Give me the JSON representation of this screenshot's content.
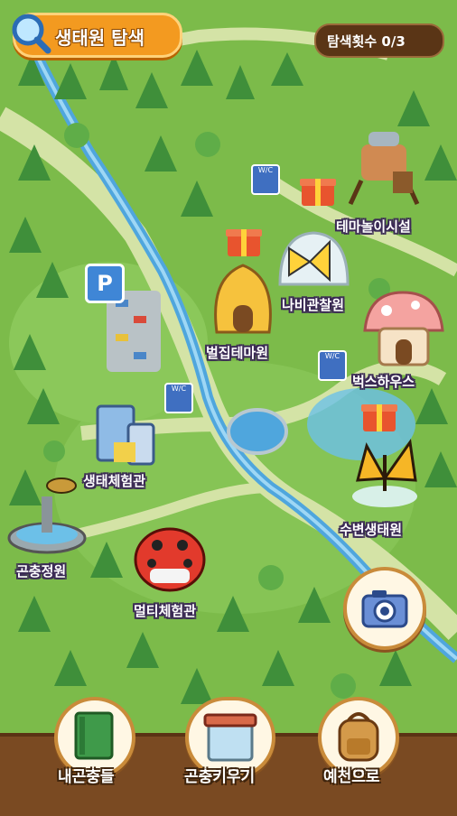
{
  "header": {
    "title": "생태원 탐색",
    "search_count": "탐색횟수 0/3"
  },
  "map": {
    "locations": [
      {
        "label": "테마놀이시설"
      },
      {
        "label": "나비관찰원"
      },
      {
        "label": "벌집테마원"
      },
      {
        "label": "벅스하우스"
      },
      {
        "label": "생태체험관"
      },
      {
        "label": "수변생태원"
      },
      {
        "label": "곤충정원"
      },
      {
        "label": "멀티체험관"
      }
    ],
    "toilet_sign": "W/C",
    "parking_sign": "P"
  },
  "bottom_nav": {
    "my_insects": "내곤충들",
    "raise_insects": "곤충키우기",
    "go_to_yecheon": "예천으로"
  },
  "colors": {
    "grass": "#7cbb4a",
    "path": "#c9d99a",
    "river": "#4fa6dd",
    "accent_orange": "#f39a20",
    "wood": "#7a4a22"
  }
}
